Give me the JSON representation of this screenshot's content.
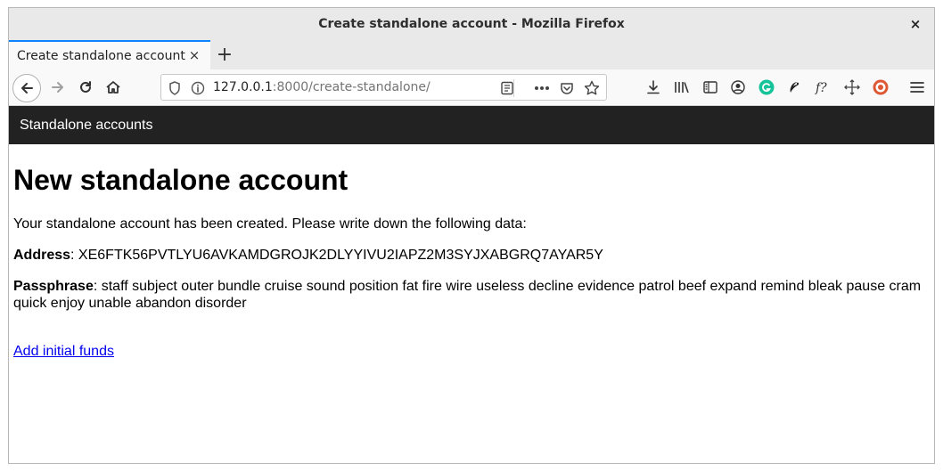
{
  "window": {
    "title": "Create standalone account - Mozilla Firefox",
    "close_glyph": "×"
  },
  "tabs": [
    {
      "label": "Create standalone account",
      "close_glyph": "×"
    }
  ],
  "newtab_glyph": "+",
  "urlbar": {
    "host": "127.0.0.1",
    "rest": ":8000/create-standalone/"
  },
  "icons": {
    "back": "back-arrow-icon",
    "forward": "forward-arrow-icon",
    "reload": "reload-icon",
    "home": "home-icon",
    "shield": "tracking-shield-icon",
    "info": "site-info-icon",
    "reader": "reader-view-icon",
    "more": "page-actions-icon",
    "pocket": "pocket-icon",
    "bookmark": "bookmark-star-icon",
    "download": "download-icon",
    "library": "library-icon",
    "sidebar": "sidebar-icon",
    "account": "account-icon",
    "grammarly": "grammarly-icon",
    "extension_bird": "extension-bird-icon",
    "fx": "fx-extension-icon",
    "move": "move-extension-icon",
    "duckduckgo": "duckduckgo-icon",
    "menu": "hamburger-menu-icon"
  },
  "colors": {
    "accent": "#0a84ff",
    "site_nav_bg": "#222222",
    "link": "#0000ee",
    "grammarly": "#15c39a",
    "duckduckgo": "#de5833"
  },
  "site": {
    "brand": "Standalone accounts"
  },
  "main": {
    "heading": "New standalone account",
    "intro": "Your standalone account has been created. Please write down the following data:",
    "address_label": "Address",
    "address_value": ": XE6FTK56PVTLYU6AVKAMDGROJK2DLYYIVU2IAPZ2M3SYJXABGRQ7AYAR5Y",
    "passphrase_label": "Passphrase",
    "passphrase_value": ": staff subject outer bundle cruise sound position fat fire wire useless decline evidence patrol beef expand remind bleak pause cram quick enjoy unable abandon disorder",
    "link_text": "Add initial funds"
  }
}
